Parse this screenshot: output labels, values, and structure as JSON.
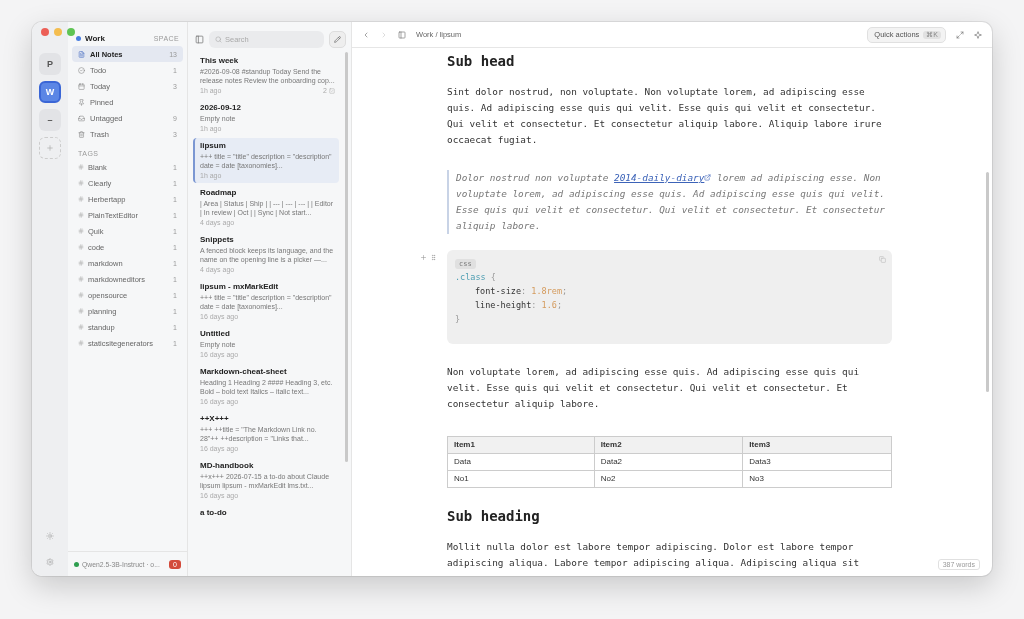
{
  "spaces": [
    {
      "label": "P",
      "selected": false
    },
    {
      "label": "W",
      "selected": true
    },
    {
      "label": "–",
      "selected": false
    }
  ],
  "sidebar": {
    "space": {
      "name": "Work",
      "label": "SPACE",
      "color": "#4a7ee0"
    },
    "items": [
      {
        "label": "All Notes",
        "count": "13",
        "selected": true
      },
      {
        "label": "Todo",
        "count": "1",
        "selected": false
      },
      {
        "label": "Today",
        "count": "3",
        "selected": false
      },
      {
        "label": "Pinned",
        "selected": false
      },
      {
        "label": "Untagged",
        "count": "9",
        "selected": false
      },
      {
        "label": "Trash",
        "count": "3",
        "selected": false
      }
    ],
    "tags_heading": "TAGS",
    "tags": [
      {
        "label": "Blank",
        "count": "1"
      },
      {
        "label": "Clearly",
        "count": "1"
      },
      {
        "label": "Herbertapp",
        "count": "1"
      },
      {
        "label": "PlainTextEditor",
        "count": "1"
      },
      {
        "label": "Quik",
        "count": "1"
      },
      {
        "label": "code",
        "count": "1"
      },
      {
        "label": "markdown",
        "count": "1"
      },
      {
        "label": "markdowneditors",
        "count": "1"
      },
      {
        "label": "opensource",
        "count": "1"
      },
      {
        "label": "planning",
        "count": "1"
      },
      {
        "label": "standup",
        "count": "1"
      },
      {
        "label": "staticsitegenerators",
        "count": "1"
      }
    ],
    "model": {
      "name": "Qwen2.5-3B-Instruct · o...",
      "badge": "0",
      "color": "#2e9e4f"
    }
  },
  "note_list": {
    "search": {
      "placeholder": "Search"
    },
    "notes": [
      {
        "title": "This week",
        "preview": "#2026-09-08 #standup Today Send the release notes Review the onboarding cop...",
        "time": "1h ago",
        "badge": "2",
        "selected": false
      },
      {
        "title": "2026-09-12",
        "preview": "Empty note",
        "time": "1h ago",
        "selected": false
      },
      {
        "title": "lipsum",
        "preview": "+++ title = \"title\" description = \"description\" date = date [taxonomies]...",
        "time": "1h ago",
        "selected": true
      },
      {
        "title": "Roadmap",
        "preview": "| Area | Status | Ship | | --- | --- | --- | | Editor | In review | Oct | | Sync | Not start...",
        "time": "4 days ago",
        "selected": false
      },
      {
        "title": "Snippets",
        "preview": "A fenced block keeps its language, and the name on the opening line is a picker —...",
        "time": "4 days ago",
        "selected": false
      },
      {
        "title": "lipsum - mxMarkEdit",
        "preview": "+++ title = \"title\" description = \"description\" date = date [taxonomies]...",
        "time": "16 days ago",
        "selected": false
      },
      {
        "title": "Untitled",
        "preview": "Empty note",
        "time": "16 days ago",
        "selected": false
      },
      {
        "title": "Markdown-cheat-sheet",
        "preview": "Heading 1 Heading 2 #### Heading 3, etc. Bold – bold text Italics – italic text...",
        "time": "16 days ago",
        "selected": false
      },
      {
        "title": "++X+++",
        "preview": "+++ ++title = \"The Markdown Link no. 28\"++ ++description = \"Links that...",
        "time": "16 days ago",
        "selected": false
      },
      {
        "title": "MD-handbook",
        "preview": "++x+++ 2026-07-15 a to-do about Claude lipsum lipsum - mxMarkEdit lms.txt...",
        "time": "16 days ago",
        "selected": false
      },
      {
        "title": "a to-do",
        "selected": false
      }
    ]
  },
  "editor": {
    "breadcrumb": "Work / lipsum",
    "quick_actions": {
      "label": "Quick actions",
      "shortcut": "⌘K"
    },
    "word_count": "387 words",
    "blocks": [
      {
        "kind": "heading",
        "text": "Sub head"
      },
      {
        "kind": "paragraph",
        "text": "Sint dolor nostrud, non voluptate. Non voluptate lorem, ad adipiscing esse quis. Ad adipiscing esse quis qui velit. Esse quis qui velit et consectetur. Qui velit et consectetur. Et consectetur aliquip labore. Aliquip labore irure occaecat fugiat."
      },
      {
        "kind": "quote",
        "before": "Dolor nostrud non voluptate ",
        "link": "2014-daily-diary",
        "after": " lorem ad adipiscing esse. Non voluptate lorem, ad adipiscing esse quis. Ad adipiscing esse quis qui velit. Esse quis qui velit et consectetur. Qui velit et consectetur. Et consectetur aliquip labore."
      },
      {
        "kind": "code",
        "lang": "css",
        "lines": [
          {
            "indent": false,
            "tokens": [
              {
                "kind": "selector",
                "text": ".class"
              },
              {
                "kind": "punct",
                "text": " {"
              }
            ]
          },
          {
            "indent": true,
            "tokens": [
              {
                "kind": "property",
                "text": "font-size"
              },
              {
                "kind": "punct",
                "text": ": "
              },
              {
                "kind": "number",
                "text": "1.8rem"
              },
              {
                "kind": "punct",
                "text": ";"
              }
            ]
          },
          {
            "indent": true,
            "tokens": [
              {
                "kind": "property",
                "text": "line-height"
              },
              {
                "kind": "punct",
                "text": ": "
              },
              {
                "kind": "number",
                "text": "1.6"
              },
              {
                "kind": "punct",
                "text": ";"
              }
            ]
          },
          {
            "indent": false,
            "tokens": [
              {
                "kind": "punct",
                "text": "}"
              }
            ]
          }
        ]
      },
      {
        "kind": "paragraph",
        "text": "Non voluptate lorem, ad adipiscing esse quis. Ad adipiscing esse quis qui velit. Esse quis qui velit et consectetur. Qui velit et consectetur. Et consectetur aliquip labore."
      },
      {
        "kind": "table",
        "columns": [
          "Item1",
          "Item2",
          "Item3"
        ],
        "rows": [
          [
            "Data",
            "Data2",
            "Data3"
          ],
          [
            "No1",
            "No2",
            "No3"
          ]
        ]
      },
      {
        "kind": "heading",
        "text": "Sub heading"
      },
      {
        "kind": "paragraph",
        "text": "Mollit nulla dolor est labore tempor adipiscing. Dolor est labore tempor adipiscing aliqua. Labore tempor adipiscing aliqua. Adipiscing aliqua sit"
      }
    ]
  }
}
